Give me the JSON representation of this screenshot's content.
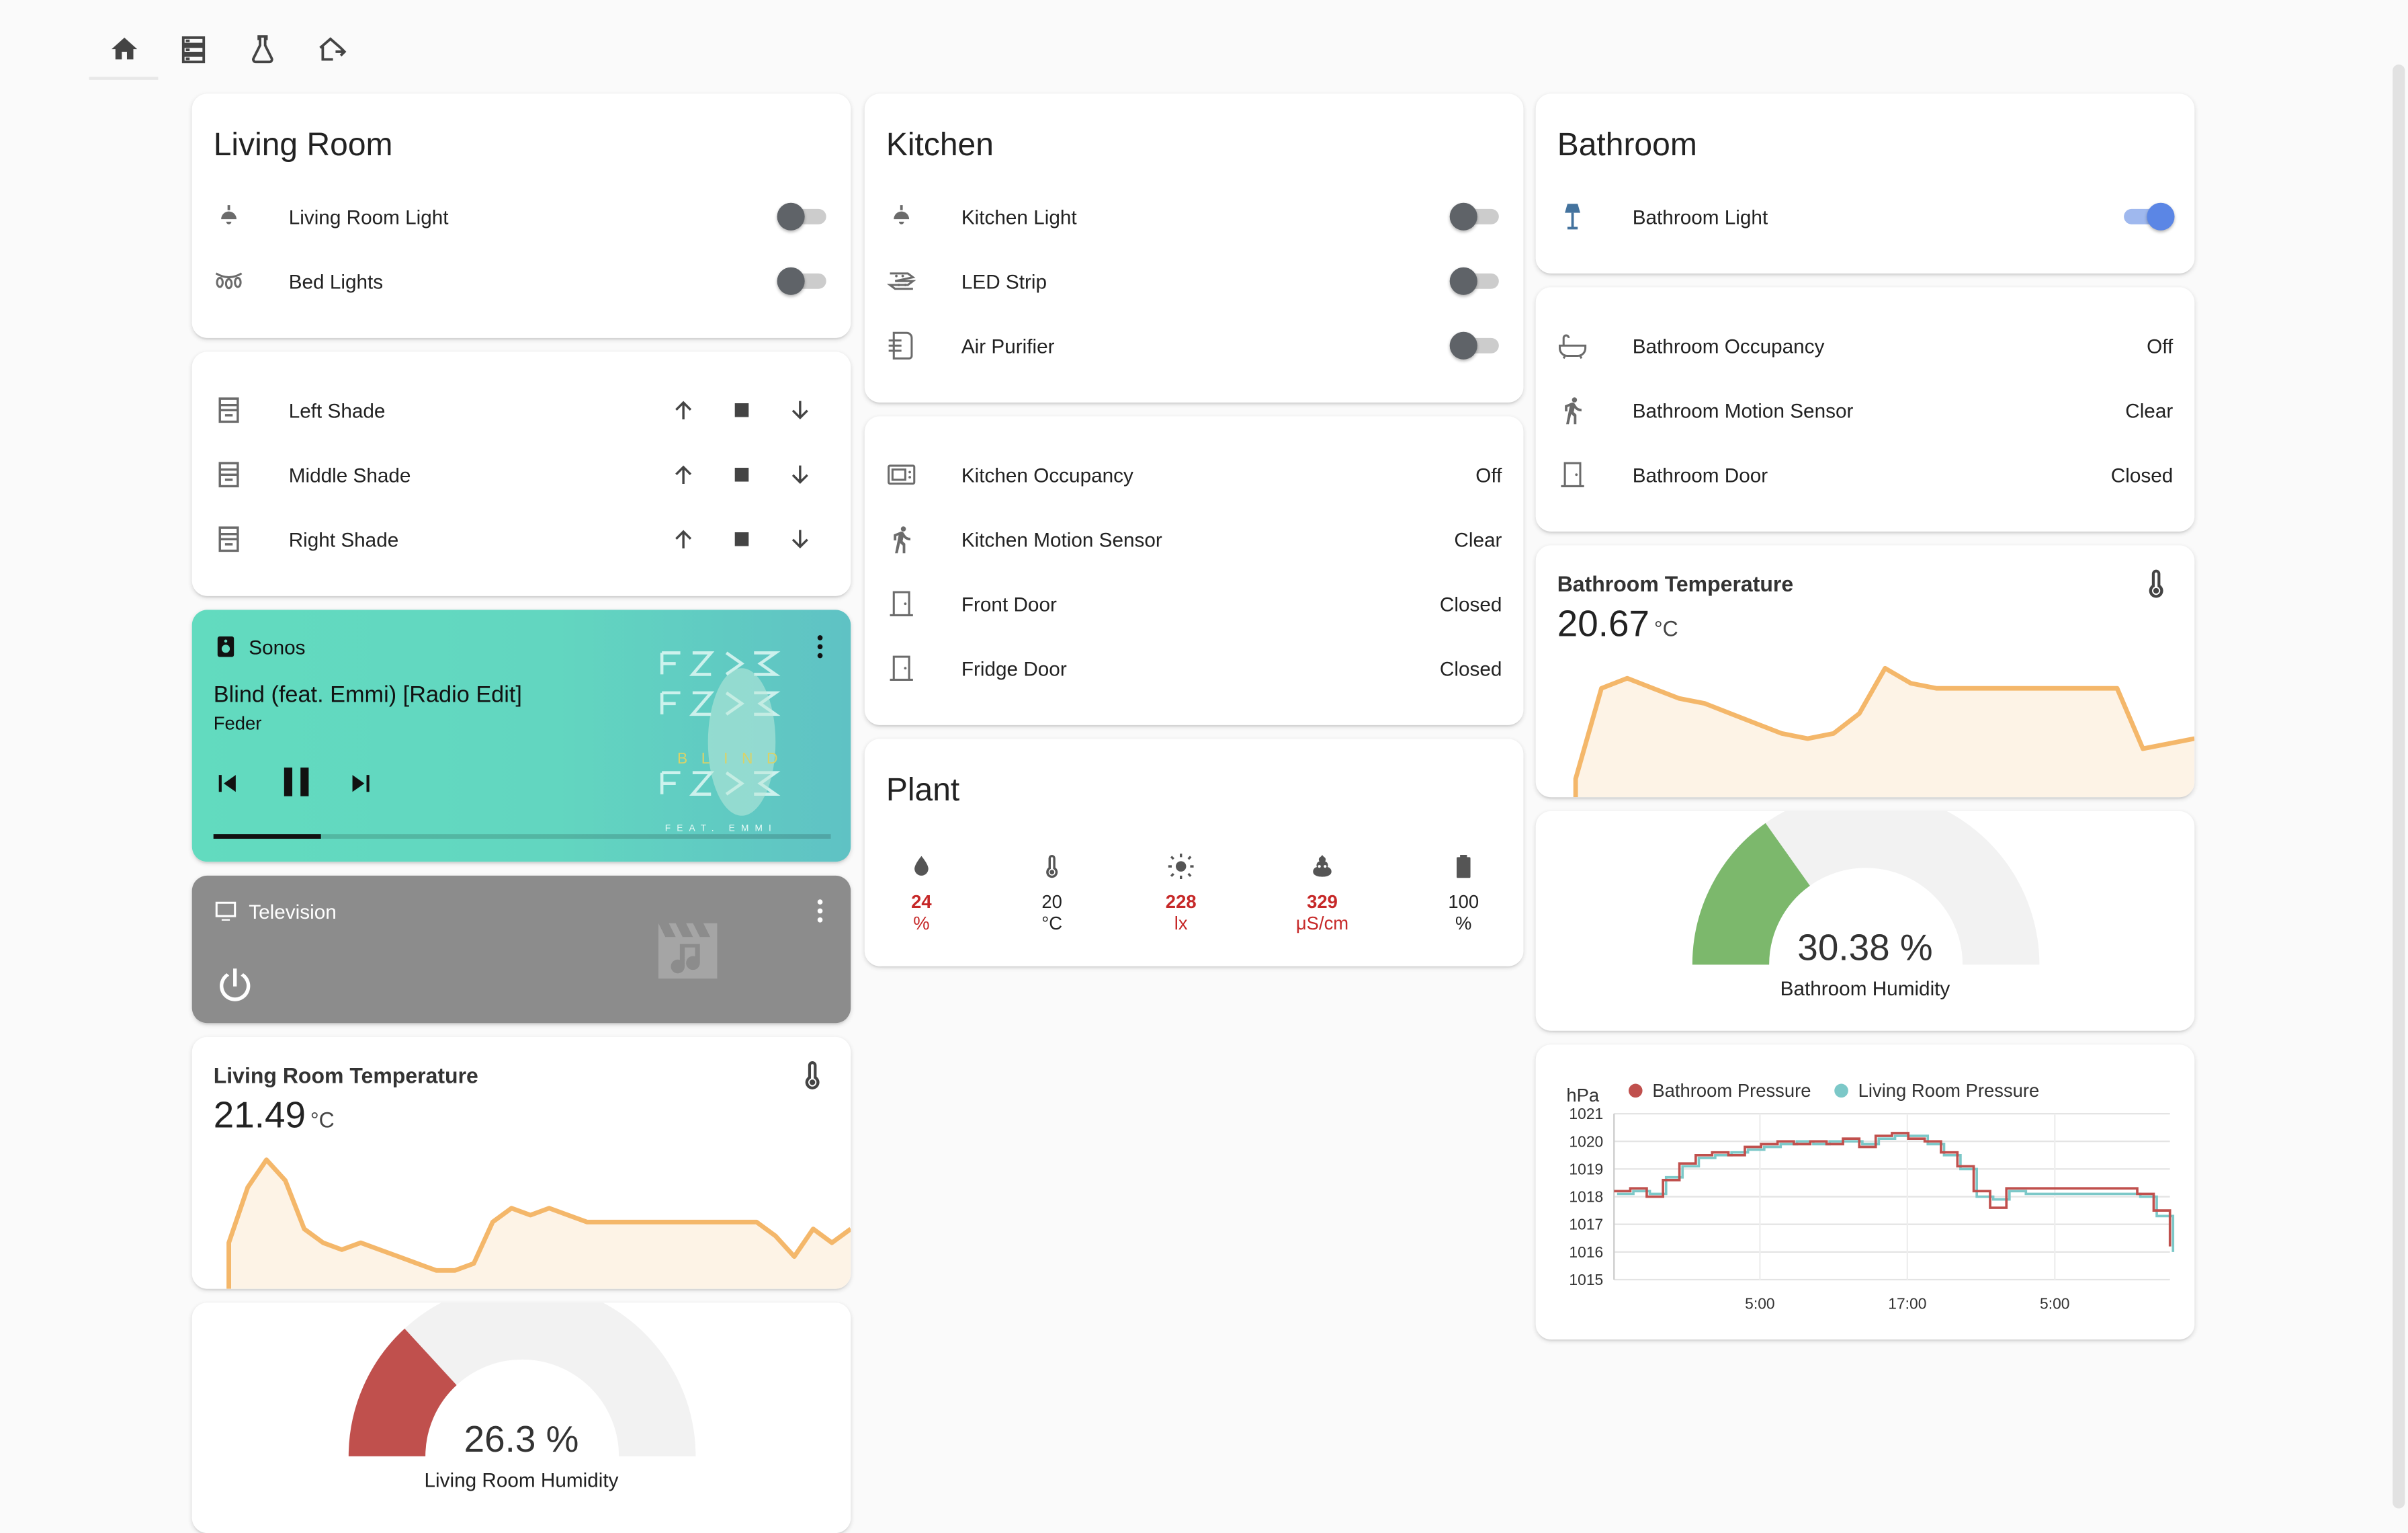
{
  "toolbar": {
    "tabs": [
      {
        "icon": "home-icon"
      },
      {
        "icon": "server-icon"
      },
      {
        "icon": "flask-icon"
      },
      {
        "icon": "home-export-icon"
      }
    ]
  },
  "living_room": {
    "title": "Living Room",
    "items": [
      {
        "name": "Living Room Light",
        "state": "off",
        "icon": "ceiling-light-icon"
      },
      {
        "name": "Bed Lights",
        "state": "off",
        "icon": "string-lights-icon"
      }
    ]
  },
  "shades": {
    "items": [
      {
        "name": "Left Shade"
      },
      {
        "name": "Middle Shade"
      },
      {
        "name": "Right Shade"
      }
    ]
  },
  "sonos": {
    "player": "Sonos",
    "track": "Blind (feat. Emmi) [Radio Edit]",
    "artist": "Feder",
    "progress": 0.175,
    "art_text": "BLIND",
    "art_subtext": "FEAT. EMMI"
  },
  "television": {
    "player": "Television"
  },
  "living_room_temperature": {
    "name": "Living Room Temperature",
    "value": "21.49",
    "unit": "°C"
  },
  "living_room_humidity": {
    "value": "26.3 %",
    "name": "Living Room Humidity",
    "fraction": 0.263,
    "color": "#c0504d"
  },
  "kitchen": {
    "title": "Kitchen",
    "items": [
      {
        "name": "Kitchen Light",
        "state": "off",
        "icon": "ceiling-light-icon"
      },
      {
        "name": "LED Strip",
        "state": "off",
        "icon": "led-strip-icon"
      },
      {
        "name": "Air Purifier",
        "state": "off",
        "icon": "air-purifier-icon"
      }
    ]
  },
  "kitchen_sensors": {
    "items": [
      {
        "name": "Kitchen Occupancy",
        "state": "Off",
        "icon": "microwave-icon"
      },
      {
        "name": "Kitchen Motion Sensor",
        "state": "Clear",
        "icon": "walk-icon"
      },
      {
        "name": "Front Door",
        "state": "Closed",
        "icon": "door-icon"
      },
      {
        "name": "Fridge Door",
        "state": "Closed",
        "icon": "door-icon"
      }
    ]
  },
  "plant": {
    "title": "Plant",
    "items": [
      {
        "value": "24",
        "unit": "%",
        "warn": true,
        "icon": "water-drop-icon"
      },
      {
        "value": "20",
        "unit": "°C",
        "warn": false,
        "icon": "thermometer-icon"
      },
      {
        "value": "228",
        "unit": "lx",
        "warn": true,
        "icon": "sun-icon"
      },
      {
        "value": "329",
        "unit": "μS/cm",
        "warn": true,
        "icon": "fertilizer-icon"
      },
      {
        "value": "100",
        "unit": "%",
        "warn": false,
        "icon": "battery-icon"
      }
    ]
  },
  "bathroom": {
    "title": "Bathroom",
    "items": [
      {
        "name": "Bathroom Light",
        "state": "on",
        "icon": "floor-lamp-icon"
      }
    ]
  },
  "bathroom_sensors": {
    "items": [
      {
        "name": "Bathroom Occupancy",
        "state": "Off",
        "icon": "bathtub-icon"
      },
      {
        "name": "Bathroom Motion Sensor",
        "state": "Clear",
        "icon": "walk-icon"
      },
      {
        "name": "Bathroom Door",
        "state": "Closed",
        "icon": "door-icon"
      }
    ]
  },
  "bathroom_temperature": {
    "name": "Bathroom Temperature",
    "value": "20.67",
    "unit": "°C"
  },
  "bathroom_humidity": {
    "value": "30.38 %",
    "name": "Bathroom Humidity",
    "fraction": 0.3038,
    "color": "#7cb86c"
  },
  "colors": {
    "accent": "#5b86e5",
    "sparkline": "#f4b76a",
    "sparkfill": "#fdf3e6",
    "warn": "#c62828",
    "icon_on": "#44739e",
    "bathroom_pressure": "#c0504d",
    "living_room_pressure": "#7cc8c8"
  },
  "chart_data": [
    {
      "type": "area",
      "series": [
        {
          "values": [
            21.0,
            21.8,
            22.2,
            21.9,
            21.2,
            21.0,
            20.9,
            21.0,
            20.9,
            20.8,
            20.7,
            20.6,
            20.6,
            20.7,
            21.3,
            21.5,
            21.4,
            21.5,
            21.4,
            21.3,
            21.3,
            21.3,
            21.3,
            21.3,
            21.3,
            21.3,
            21.3,
            21.3,
            21.3,
            21.1,
            20.8,
            21.2,
            21.0,
            21.2
          ]
        }
      ]
    },
    {
      "type": "area",
      "series": [
        {
          "values": [
            19.4,
            21.2,
            21.4,
            21.2,
            21.0,
            20.9,
            20.7,
            20.5,
            20.3,
            20.2,
            20.3,
            20.7,
            21.6,
            21.3,
            21.2,
            21.2,
            21.2,
            21.2,
            21.2,
            21.2,
            21.2,
            21.2,
            20.0,
            20.1,
            20.2
          ]
        }
      ]
    },
    {
      "type": "line",
      "ylabel": "hPa",
      "ylim": [
        1015,
        1021
      ],
      "xticks": [
        "5:00",
        "17:00",
        "5:00"
      ],
      "yticks": [
        "1021",
        "1020",
        "1019",
        "1018",
        "1017",
        "1016",
        "1015"
      ],
      "series": [
        {
          "name": "Bathroom Pressure",
          "values": [
            1018.2,
            1018.3,
            1018.0,
            1018.6,
            1019.2,
            1019.5,
            1019.6,
            1019.5,
            1019.8,
            1019.9,
            1020.0,
            1019.9,
            1020.0,
            1019.9,
            1020.1,
            1019.8,
            1020.2,
            1020.3,
            1020.1,
            1020.0,
            1019.6,
            1019.1,
            1018.2,
            1017.6,
            1018.3,
            1018.3,
            1018.3,
            1018.3,
            1018.3,
            1018.3,
            1018.3,
            1018.3,
            1018.1,
            1017.5,
            1016.2
          ]
        },
        {
          "name": "Living Room Pressure",
          "values": [
            1018.1,
            1018.2,
            1018.1,
            1018.7,
            1019.1,
            1019.4,
            1019.5,
            1019.6,
            1019.7,
            1019.8,
            1019.9,
            1020.0,
            1019.9,
            1020.0,
            1020.0,
            1019.9,
            1020.1,
            1020.2,
            1020.2,
            1019.9,
            1019.5,
            1019.0,
            1018.0,
            1017.9,
            1018.2,
            1018.1,
            1018.1,
            1018.1,
            1018.1,
            1018.1,
            1018.1,
            1018.1,
            1018.0,
            1017.3,
            1016.0
          ]
        }
      ]
    }
  ]
}
